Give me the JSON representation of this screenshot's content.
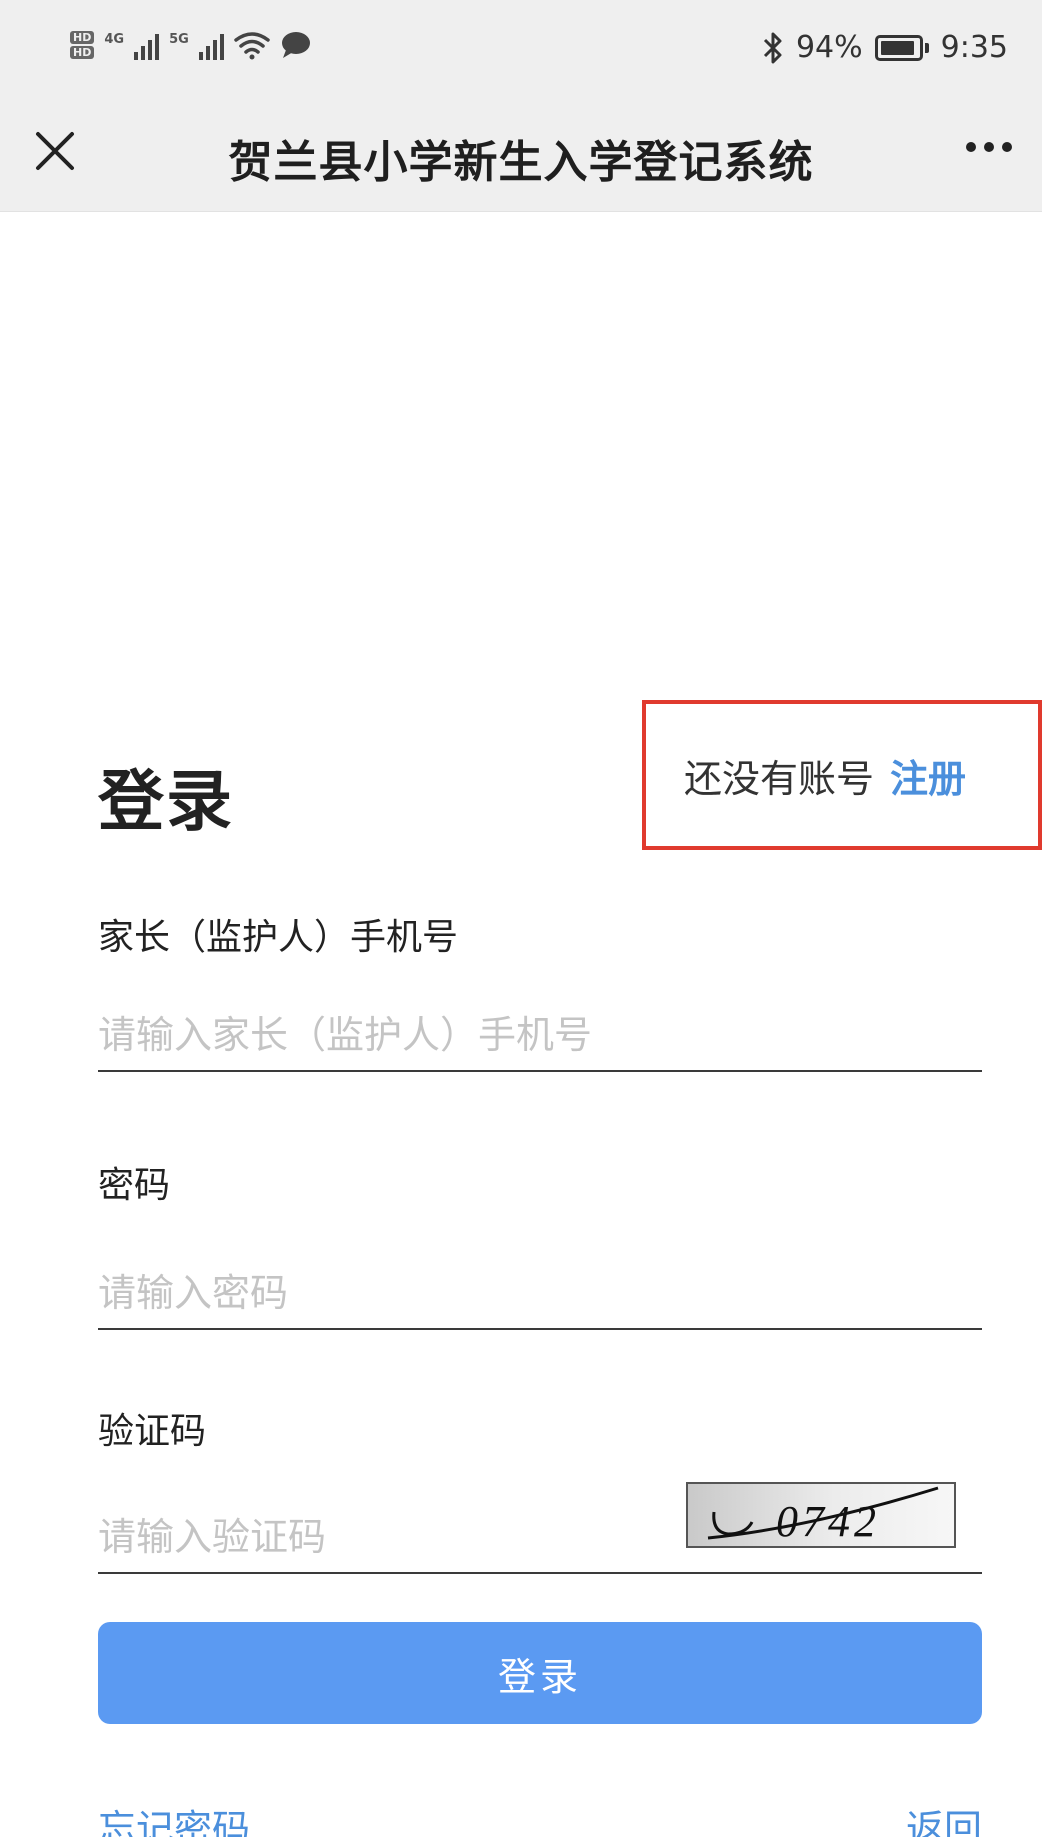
{
  "status_bar": {
    "network_1": "4G",
    "network_2": "5G",
    "battery_percent": "94%",
    "battery_level": 0.94,
    "time": "9:35"
  },
  "nav": {
    "title": "贺兰县小学新生入学登记系统"
  },
  "login": {
    "title": "登录",
    "register_prompt": "还没有账号",
    "register_link": "注册",
    "phone_label": "家长（监护人）手机号",
    "phone_placeholder": "请输入家长（监护人）手机号",
    "password_label": "密码",
    "password_placeholder": "请输入密码",
    "captcha_label": "验证码",
    "captcha_placeholder": "请输入验证码",
    "captcha_text": "0742",
    "submit_label": "登录",
    "forgot_label": "忘记密码",
    "back_label": "返回"
  },
  "colors": {
    "link": "#4b8fdc",
    "button": "#5b9af2",
    "highlight_border": "#e03a2e",
    "bar_background": "#efefef"
  },
  "icons": [
    "close-icon",
    "more-icon",
    "bluetooth-icon",
    "battery-icon",
    "wifi-icon",
    "chat-icon",
    "signal-icon"
  ]
}
